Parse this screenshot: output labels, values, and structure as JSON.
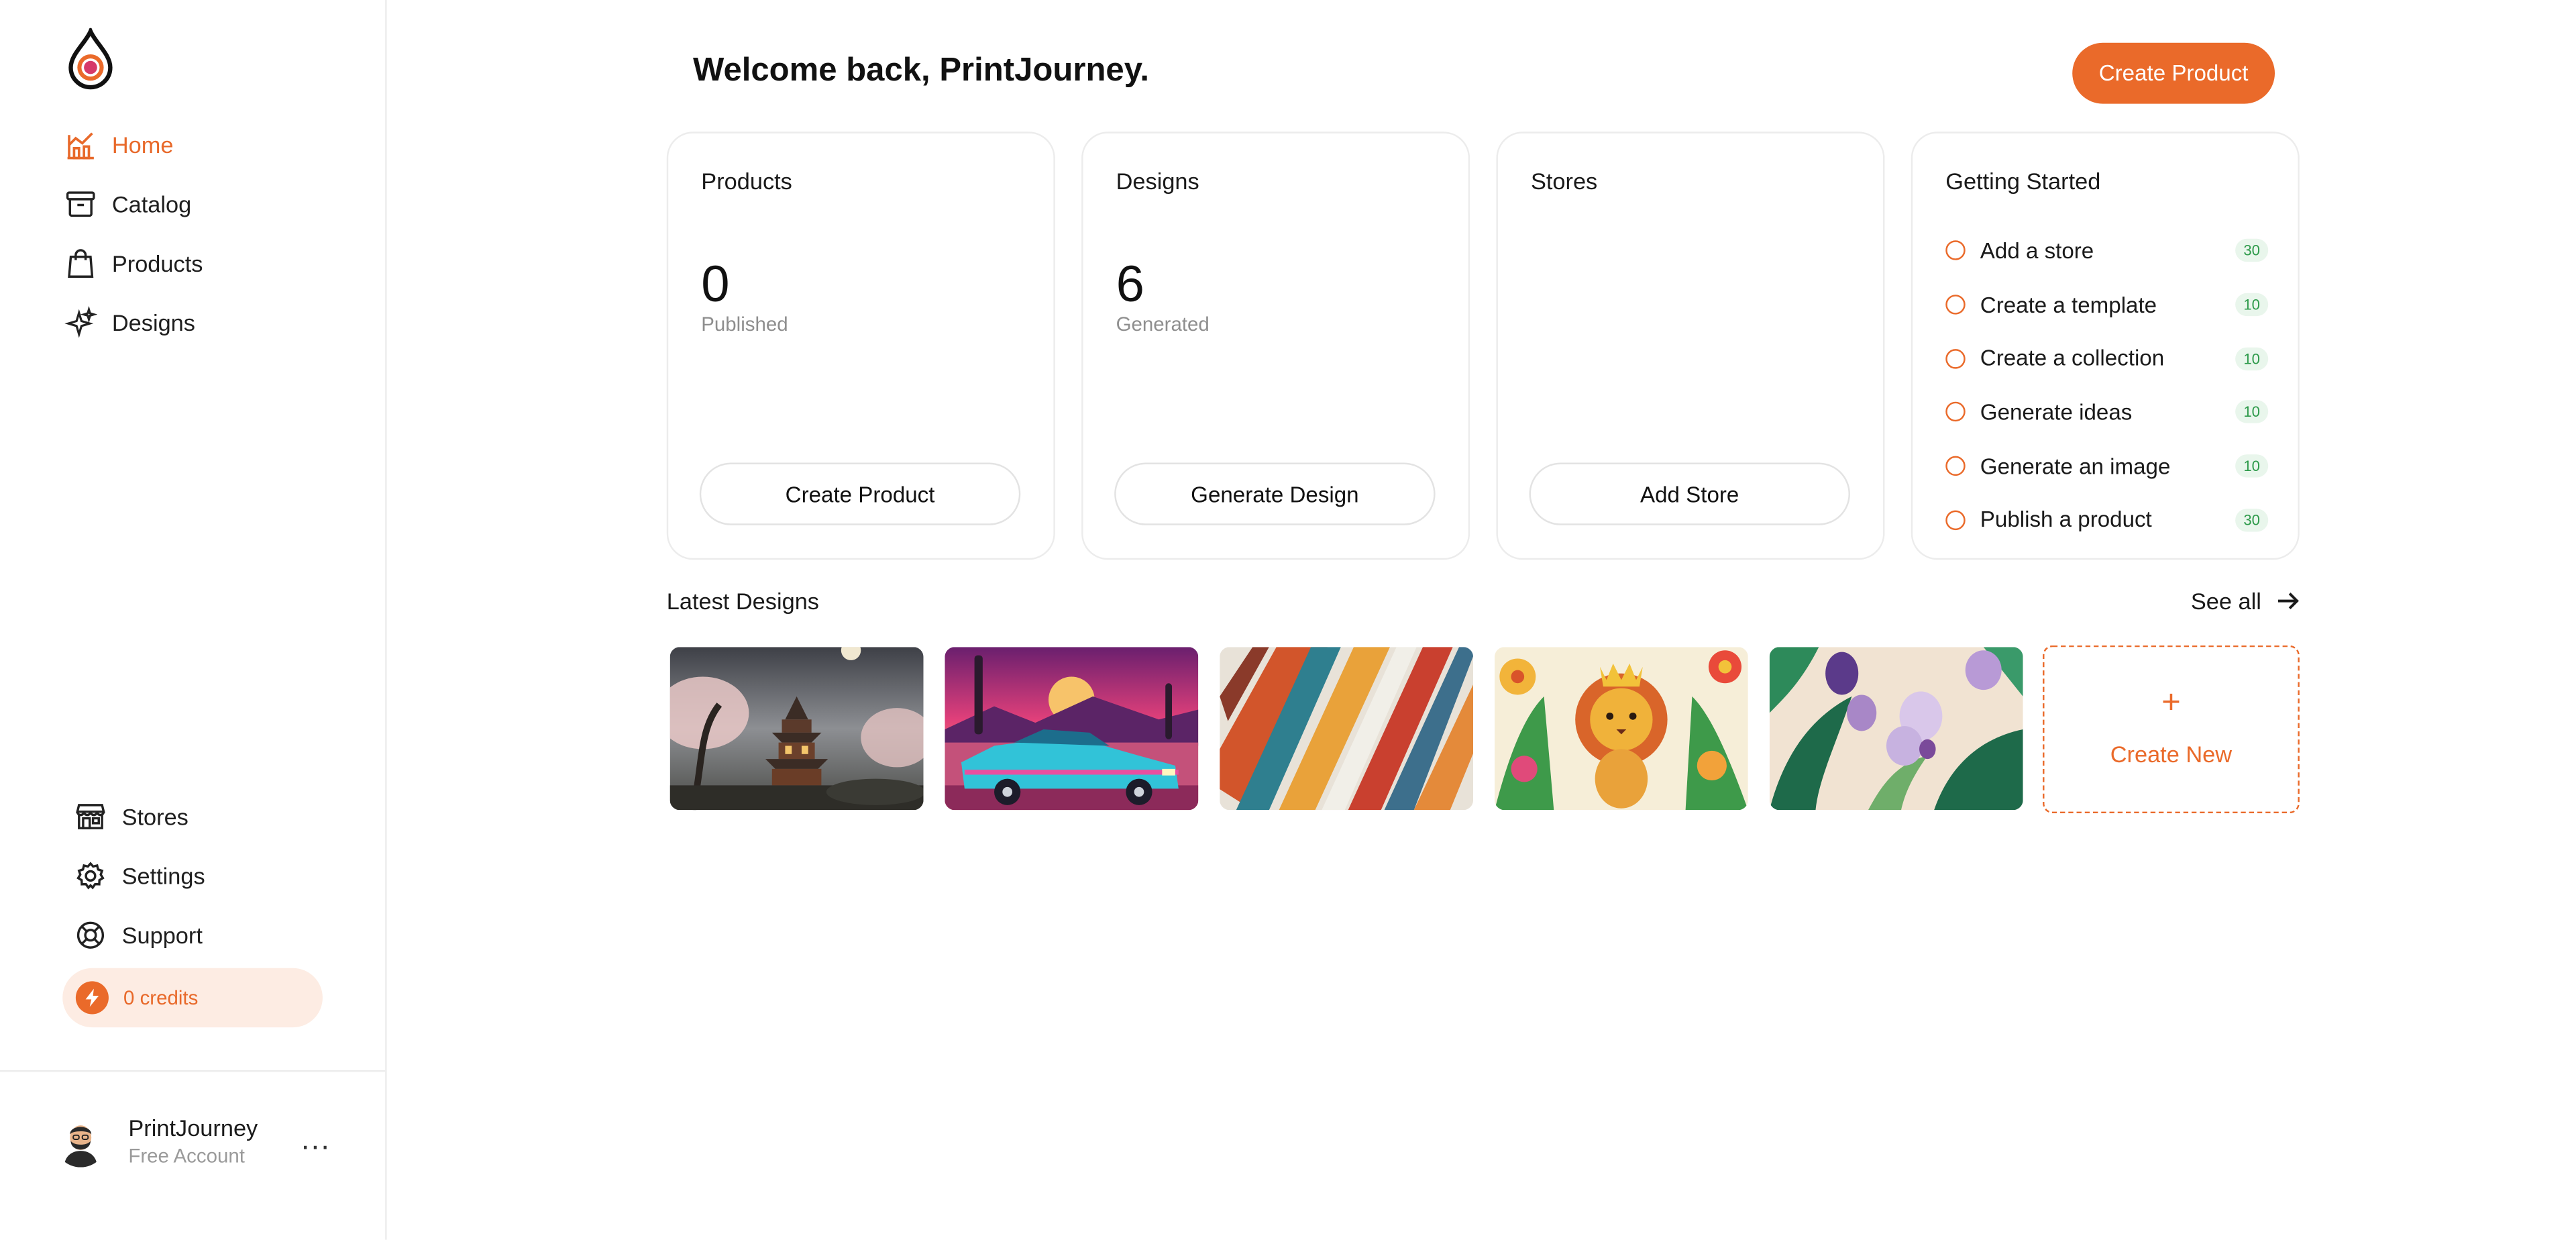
{
  "sidebar": {
    "nav": [
      {
        "label": "Home",
        "icon": "home-chart-icon",
        "active": true
      },
      {
        "label": "Catalog",
        "icon": "archive-box-icon",
        "active": false
      },
      {
        "label": "Products",
        "icon": "shopping-bag-icon",
        "active": false
      },
      {
        "label": "Designs",
        "icon": "sparkles-icon",
        "active": false
      }
    ],
    "bottom_nav": [
      {
        "label": "Stores",
        "icon": "storefront-icon"
      },
      {
        "label": "Settings",
        "icon": "gear-icon"
      },
      {
        "label": "Support",
        "icon": "lifebuoy-icon"
      }
    ],
    "credits_label": "0 credits",
    "user": {
      "name": "PrintJourney",
      "plan": "Free Account",
      "menu": "..."
    }
  },
  "header": {
    "welcome": "Welcome back, PrintJourney.",
    "create_product": "Create Product"
  },
  "cards": {
    "products": {
      "title": "Products",
      "value": "0",
      "sub": "Published",
      "button": "Create Product"
    },
    "designs": {
      "title": "Designs",
      "value": "6",
      "sub": "Generated",
      "button": "Generate Design"
    },
    "stores": {
      "title": "Stores",
      "button": "Add Store"
    },
    "getting_started": {
      "title": "Getting Started",
      "items": [
        {
          "label": "Add a store",
          "points": "30"
        },
        {
          "label": "Create a template",
          "points": "10"
        },
        {
          "label": "Create a collection",
          "points": "10"
        },
        {
          "label": "Generate ideas",
          "points": "10"
        },
        {
          "label": "Generate an image",
          "points": "10"
        },
        {
          "label": "Publish a product",
          "points": "30"
        }
      ]
    }
  },
  "latest": {
    "title": "Latest Designs",
    "see_all": "See all",
    "create_new": "Create New",
    "plus": "+"
  },
  "colors": {
    "accent": "#ea6a2a",
    "accent_soft": "#fdece3",
    "badge_green": "#2d9a4a"
  }
}
